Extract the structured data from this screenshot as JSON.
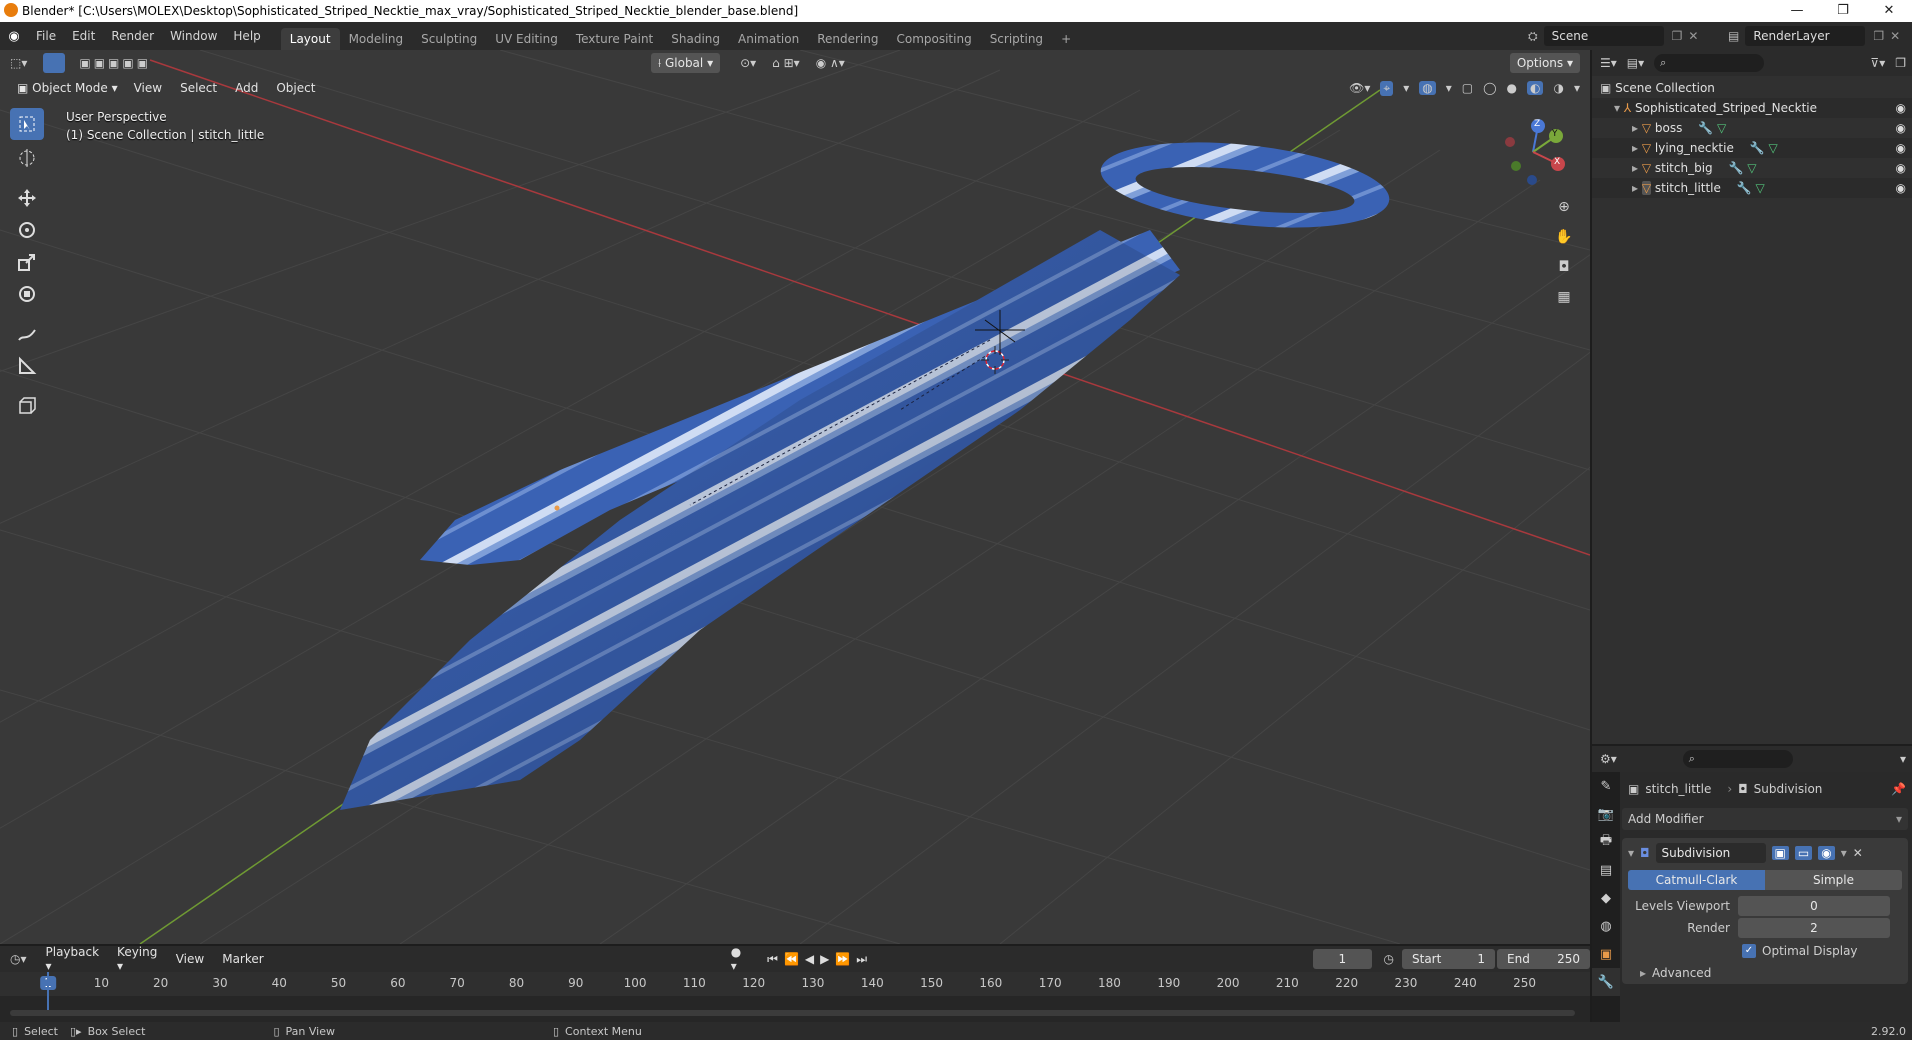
{
  "title_bar": {
    "title": "Blender* [C:\\Users\\MOLEX\\Desktop\\Sophisticated_Striped_Necktie_max_vray/Sophisticated_Striped_Necktie_blender_base.blend]",
    "minimize": "—",
    "maximize": "❐",
    "close": "✕"
  },
  "menu": {
    "items": [
      "File",
      "Edit",
      "Render",
      "Window",
      "Help"
    ]
  },
  "workspaces": {
    "tabs": [
      "Layout",
      "Modeling",
      "Sculpting",
      "UV Editing",
      "Texture Paint",
      "Shading",
      "Animation",
      "Rendering",
      "Compositing",
      "Scripting"
    ],
    "add": "+"
  },
  "scene": {
    "name": "Scene",
    "view_layer": "RenderLayer"
  },
  "viewport": {
    "transform_orientation": "Global",
    "options_label": "Options",
    "mode": "Object Mode",
    "menus": [
      "View",
      "Select",
      "Add",
      "Object"
    ],
    "perspective": "User Perspective",
    "collection_info": "(1) Scene Collection | stitch_little",
    "gizmo_axes": {
      "x": "X",
      "y": "Y",
      "z": "Z"
    }
  },
  "outliner": {
    "root": "Scene Collection",
    "collection": "Sophisticated_Striped_Necktie",
    "objects": [
      "boss",
      "lying_necktie",
      "stitch_big",
      "stitch_little"
    ]
  },
  "properties": {
    "object_name": "stitch_little",
    "modifier_context": "Subdivision",
    "add_modifier": "Add Modifier",
    "modifier": {
      "name": "Subdivision",
      "type_catmull": "Catmull-Clark",
      "type_simple": "Simple",
      "levels_viewport_label": "Levels Viewport",
      "levels_viewport": "0",
      "render_label": "Render",
      "render": "2",
      "optimal_display_label": "Optimal Display",
      "advanced_label": "Advanced"
    }
  },
  "timeline": {
    "menus": [
      "Playback",
      "Keying",
      "View",
      "Marker"
    ],
    "current_frame": "1",
    "start_label": "Start",
    "start": "1",
    "end_label": "End",
    "end": "250",
    "frame_ticks": [
      "1",
      "10",
      "20",
      "30",
      "40",
      "50",
      "60",
      "70",
      "80",
      "90",
      "100",
      "110",
      "120",
      "130",
      "140",
      "150",
      "160",
      "170",
      "180",
      "190",
      "200",
      "210",
      "220",
      "230",
      "240",
      "250"
    ]
  },
  "status_bar": {
    "select": "Select",
    "box_select": "Box Select",
    "pan_view": "Pan View",
    "context_menu": "Context Menu",
    "version": "2.92.0"
  },
  "colors": {
    "accent": "#4772b3",
    "tie_blue": "#3b63b5",
    "stripe": "#d8e4f7",
    "axis_x": "#c8464b",
    "axis_y": "#7aa83a",
    "object_orange": "#e89a4a"
  }
}
